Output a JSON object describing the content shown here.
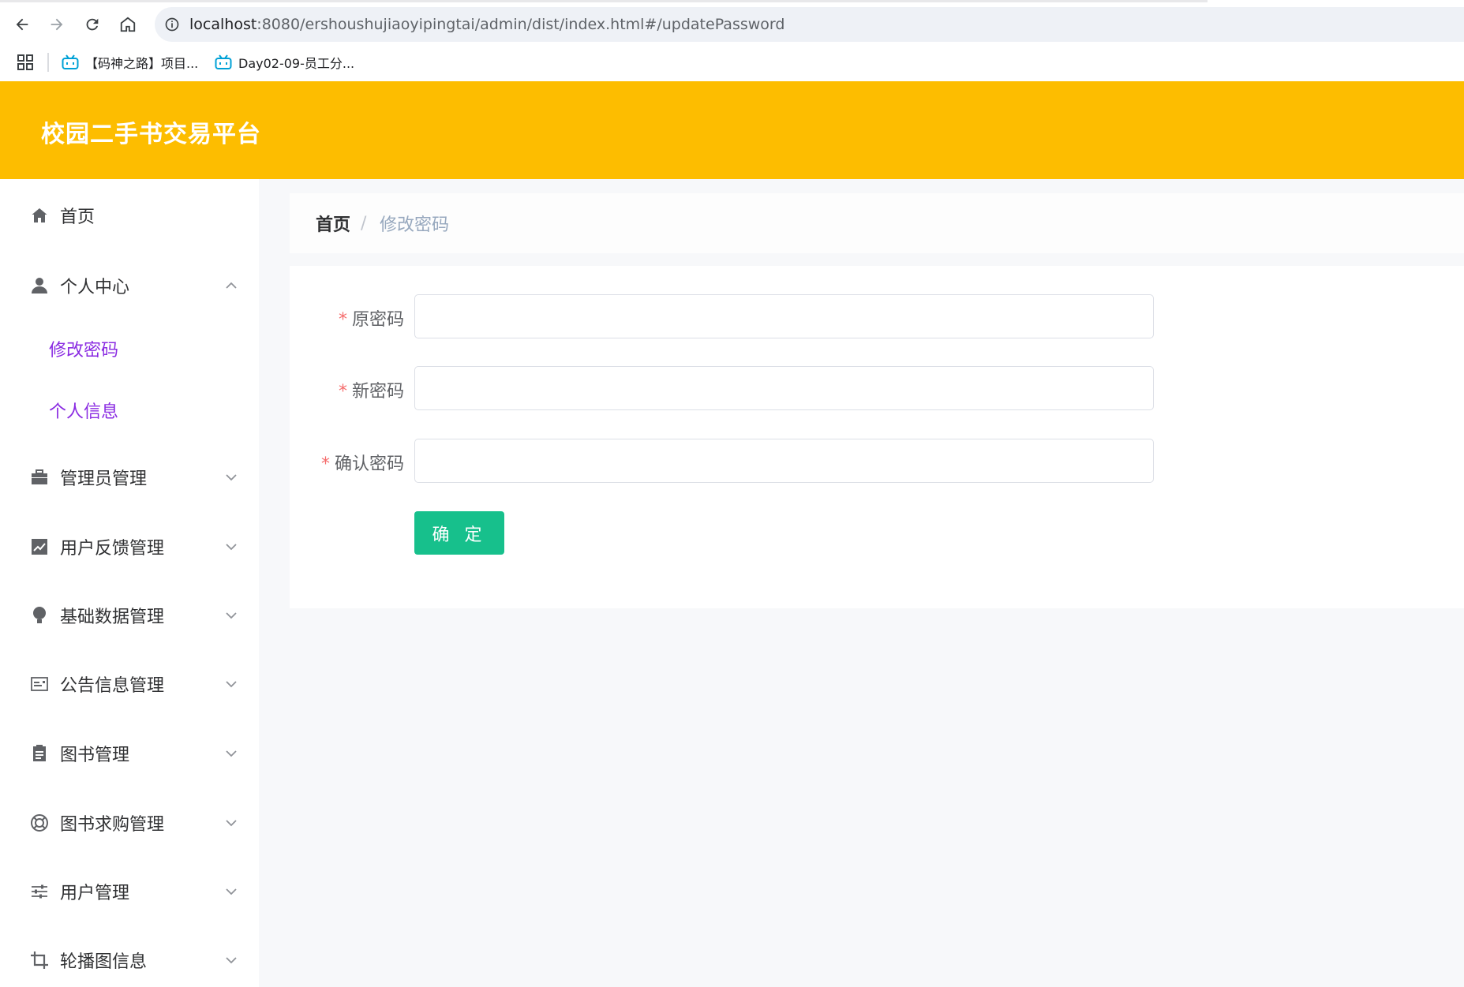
{
  "browser": {
    "url_host": "localhost",
    "url_path": ":8080/ershoushujiaoyipingtai/admin/dist/index.html#/updatePassword",
    "bookmarks": [
      {
        "label": "【码神之路】项目..."
      },
      {
        "label": "Day02-09-员工分..."
      }
    ]
  },
  "header": {
    "title": "校园二手书交易平台"
  },
  "sidebar": {
    "items": [
      {
        "label": "首页",
        "icon": "home-icon"
      },
      {
        "label": "个人中心",
        "icon": "user-icon",
        "expanded": true,
        "children": [
          {
            "label": "修改密码"
          },
          {
            "label": "个人信息"
          }
        ]
      },
      {
        "label": "管理员管理",
        "icon": "briefcase-icon"
      },
      {
        "label": "用户反馈管理",
        "icon": "chart-icon"
      },
      {
        "label": "基础数据管理",
        "icon": "bulb-icon"
      },
      {
        "label": "公告信息管理",
        "icon": "card-icon"
      },
      {
        "label": "图书管理",
        "icon": "clipboard-icon"
      },
      {
        "label": "图书求购管理",
        "icon": "lifebuoy-icon"
      },
      {
        "label": "用户管理",
        "icon": "sliders-icon"
      },
      {
        "label": "轮播图信息",
        "icon": "crop-icon"
      }
    ]
  },
  "breadcrumb": {
    "home": "首页",
    "separator": "/",
    "current": "修改密码"
  },
  "form": {
    "required_mark": "*",
    "fields": [
      {
        "label": "原密码",
        "value": ""
      },
      {
        "label": "新密码",
        "value": ""
      },
      {
        "label": "确认密码",
        "value": ""
      }
    ],
    "submit_label": "确 定"
  },
  "colors": {
    "header_bg": "#fdbd00",
    "submenu_text": "#8a2be2",
    "submit_bg": "#17c08c",
    "required": "#f56c6c"
  }
}
